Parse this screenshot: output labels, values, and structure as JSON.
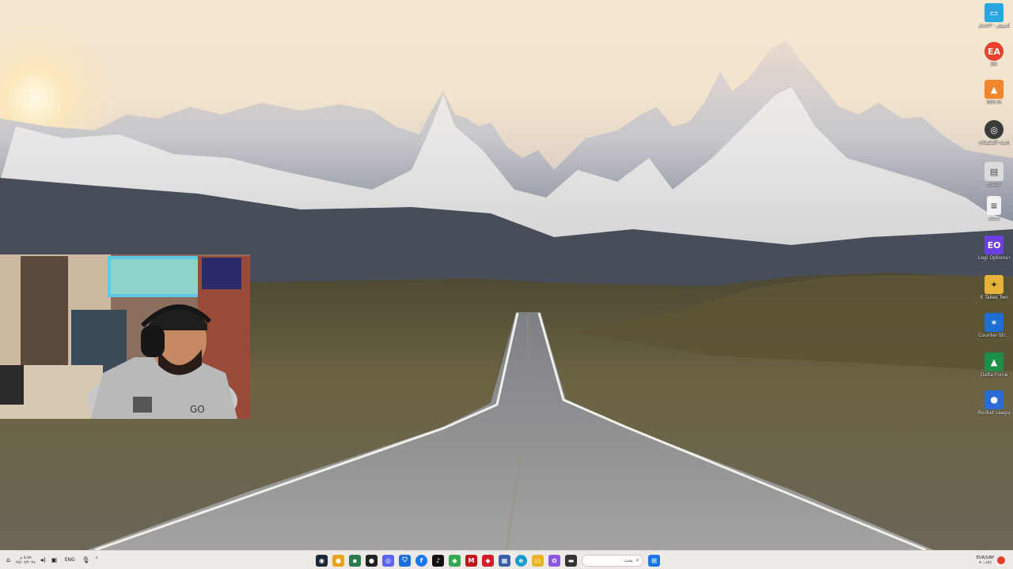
{
  "desktop": {
    "icons": [
      {
        "label": "هذا الكمبيوتر - اختصار",
        "icon": "monitor-icon",
        "color": "#2aa7e0"
      },
      {
        "label": "EA",
        "icon": "ea-icon",
        "color": "#e8412c"
      },
      {
        "label": "itch.io",
        "icon": "itch-icon",
        "color": "#f0872c"
      },
      {
        "label": "تحديث التطبيقات",
        "icon": "update-circle-icon",
        "color": "#3a3a3a"
      },
      {
        "label": "اختصار",
        "icon": "window-icon",
        "color": "#dcdcdc"
      },
      {
        "label": "مستند",
        "icon": "document-icon",
        "color": "#f2f2f2"
      },
      {
        "label": "Logi Options+",
        "icon": "logi-icon",
        "color": "#6b3fe0"
      },
      {
        "label": "It Takes Two",
        "icon": "it-takes-two-icon",
        "color": "#e6b23a"
      },
      {
        "label": "Counter-Str...",
        "icon": "counter-strike-icon",
        "color": "#1f6ed6"
      },
      {
        "label": "Delta Force",
        "icon": "delta-force-icon",
        "color": "#1e8f4a"
      },
      {
        "label": "Rocket League®",
        "icon": "rocket-league-icon",
        "color": "#2a6bd6"
      }
    ]
  },
  "taskbar": {
    "clock": {
      "time": "٥:٥٩ م",
      "date": "٢٨/٠٦/٢٠٢٤"
    },
    "language": "ENG",
    "search_placeholder": "بحث",
    "currency": "EUR/GBP",
    "currency_sub": "+٠٫١٥٪",
    "apps": [
      {
        "name": "steam",
        "color": "#1b2838"
      },
      {
        "name": "chrome",
        "color": "#e8a317"
      },
      {
        "name": "terminal",
        "color": "#2b7a4b"
      },
      {
        "name": "github",
        "color": "#222222"
      },
      {
        "name": "discord",
        "color": "#5865f2"
      },
      {
        "name": "shield",
        "color": "#1a6fe0"
      },
      {
        "name": "facebook",
        "color": "#1877f2"
      },
      {
        "name": "tiktok",
        "color": "#111111"
      },
      {
        "name": "maps",
        "color": "#34a853"
      },
      {
        "name": "mcafee",
        "color": "#c01818"
      },
      {
        "name": "gem",
        "color": "#d81b2c"
      },
      {
        "name": "calculator",
        "color": "#3c5fa8"
      },
      {
        "name": "edge",
        "color": "#1c9bd1"
      },
      {
        "name": "explorer",
        "color": "#e9b22c"
      },
      {
        "name": "photos",
        "color": "#8a56e2"
      },
      {
        "name": "editor",
        "color": "#333333"
      }
    ]
  }
}
